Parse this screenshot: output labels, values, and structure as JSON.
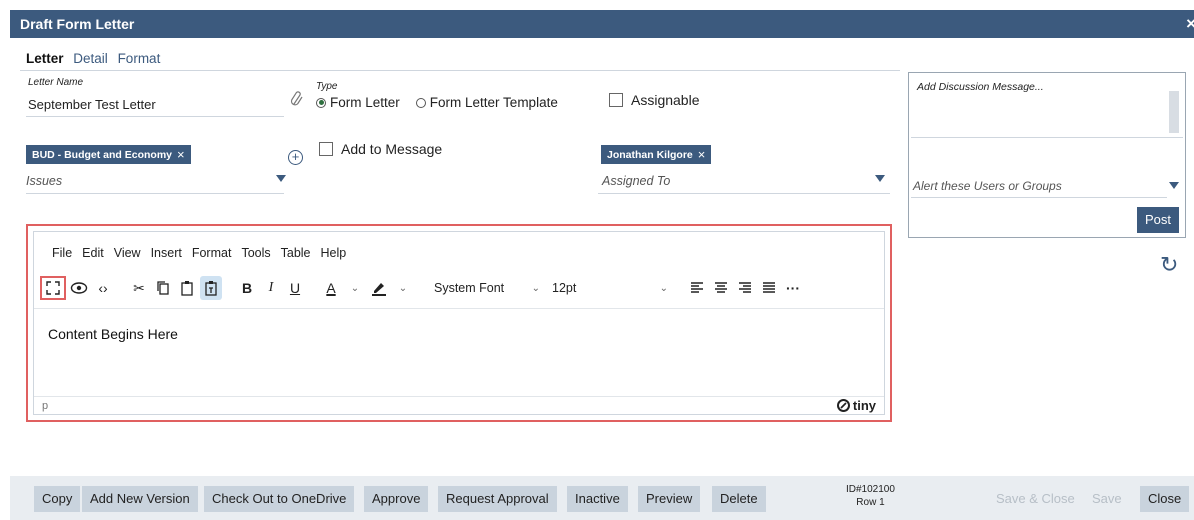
{
  "window": {
    "title": "Draft Form Letter",
    "close": "×"
  },
  "tabs": [
    {
      "label": "Letter"
    },
    {
      "label": "Detail"
    },
    {
      "label": "Format"
    }
  ],
  "letter_name": {
    "label": "Letter Name",
    "value": "September Test Letter"
  },
  "type": {
    "label": "Type",
    "options": [
      {
        "label": "Form Letter",
        "selected": true
      },
      {
        "label": "Form Letter Template",
        "selected": false
      }
    ]
  },
  "assignable": {
    "label": "Assignable",
    "checked": false
  },
  "add_to_message": {
    "label": "Add to Message",
    "checked": false
  },
  "issues": {
    "chip": "BUD - Budget and Economy",
    "placeholder": "Issues"
  },
  "assigned_to": {
    "chip": "Jonathan Kilgore",
    "placeholder": "Assigned To"
  },
  "discussion": {
    "placeholder": "Add Discussion Message...",
    "alert_placeholder": "Alert these Users or Groups",
    "post_label": "Post"
  },
  "editor": {
    "menu": [
      "File",
      "Edit",
      "View",
      "Insert",
      "Format",
      "Tools",
      "Table",
      "Help"
    ],
    "font_family": "System Font",
    "font_size": "12pt",
    "content": "Content Begins Here",
    "status_path": "p",
    "brand": "tiny"
  },
  "footer": {
    "buttons": [
      "Copy",
      "Add New Version",
      "Check Out to OneDrive",
      "Approve",
      "Request Approval",
      "Inactive",
      "Preview",
      "Delete"
    ],
    "id_line": "ID#102100",
    "row_line": "Row 1",
    "save_close": "Save & Close",
    "save": "Save",
    "close": "Close"
  },
  "colors": {
    "accent": "#3c5a7e",
    "highlight": "#e06060"
  }
}
